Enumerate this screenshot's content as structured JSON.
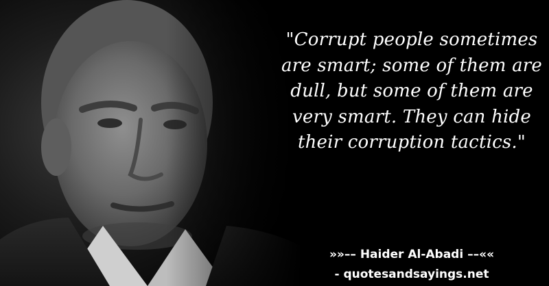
{
  "quote": {
    "text": "\"Corrupt people sometimes are smart; some of them are dull, but some of them are very smart. They can hide their corruption tactics.\""
  },
  "attribution": {
    "text": "»»–– Haider Al-Abadi ––««"
  },
  "source": {
    "text": "- quotesandsayings.net"
  },
  "colors": {
    "background": "#000000",
    "text": "#ffffff"
  }
}
